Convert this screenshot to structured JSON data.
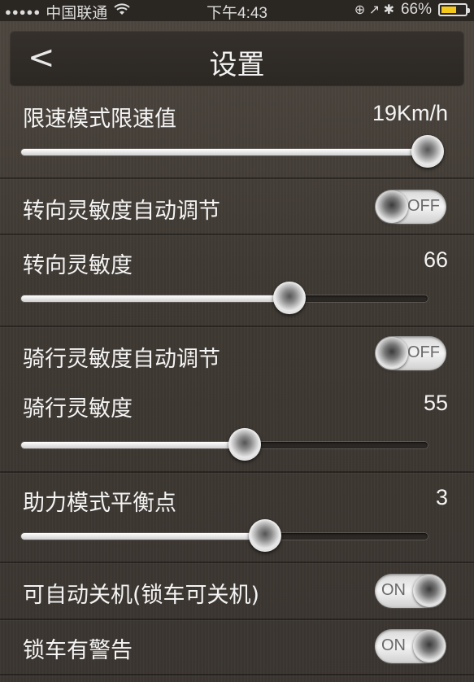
{
  "status_bar": {
    "signal": "●●●●●",
    "carrier": "中国联通",
    "wifi_icon": "wifi-icon",
    "time": "下午4:43",
    "icons": "⊕ ↗ ✱",
    "battery": "66%",
    "battery_level": 0.66,
    "battery_color": "#f3c81b"
  },
  "nav": {
    "back": "<",
    "title": "设置"
  },
  "settings": {
    "speed_limit": {
      "label": "限速模式限速值",
      "value": "19Km/h",
      "level": 1.0
    },
    "steering_auto": {
      "label": "转向灵敏度自动调节",
      "state": "OFF"
    },
    "steering": {
      "label": "转向灵敏度",
      "value": "66",
      "level": 0.66
    },
    "riding_auto": {
      "label": "骑行灵敏度自动调节",
      "state": "OFF"
    },
    "riding": {
      "label": "骑行灵敏度",
      "value": "55",
      "level": 0.55
    },
    "balance": {
      "label": "助力模式平衡点",
      "value": "3",
      "level": 0.6
    },
    "auto_shutdown": {
      "label": "可自动关机(锁车可关机)",
      "state": "ON"
    },
    "lock_alarm": {
      "label": "锁车有警告",
      "state": "ON"
    }
  }
}
